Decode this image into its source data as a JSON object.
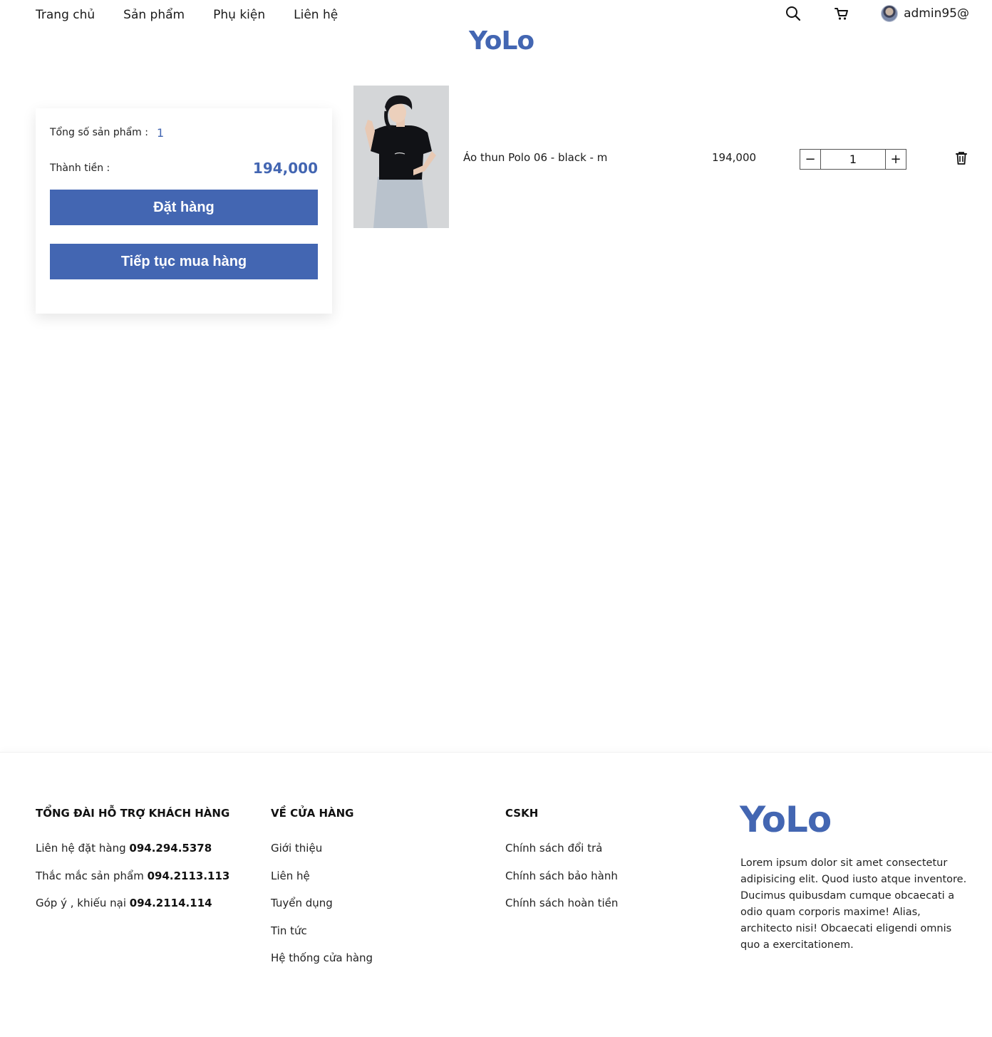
{
  "header": {
    "nav": [
      "Trang chủ",
      "Sản phẩm",
      "Phụ kiện",
      "Liên hệ"
    ],
    "logo": "YoLo",
    "username": "admin95@",
    "icons": {
      "search": "search-icon",
      "cart": "cart-icon",
      "avatar": "avatar"
    }
  },
  "summary": {
    "count_label": "Tổng số sản phẩm :",
    "count_value": "1",
    "total_label": "Thành tiền :",
    "total_value": "194,000",
    "order_button": "Đặt hàng",
    "continue_button": "Tiếp tục mua hàng"
  },
  "cart_item": {
    "name": "Áo thun Polo 06 - black - m",
    "price": "194,000",
    "quantity": "1",
    "minus_label": "−",
    "plus_label": "+"
  },
  "footer": {
    "support": {
      "title": "TỔNG ĐÀI HỖ TRỢ KHÁCH HÀNG",
      "lines": [
        {
          "label": "Liên hệ đặt hàng",
          "phone": "094.294.5378"
        },
        {
          "label": "Thắc mắc sản phẩm",
          "phone": "094.2113.113"
        },
        {
          "label": "Góp ý , khiếu nại",
          "phone": "094.2114.114"
        }
      ]
    },
    "store": {
      "title": "VỀ CỬA HÀNG",
      "links": [
        "Giới thiệu",
        "Liên hệ",
        "Tuyển dụng",
        "Tin tức",
        "Hệ thống cửa hàng"
      ]
    },
    "cskh": {
      "title": "CSKH",
      "links": [
        "Chính sách đổi trả",
        "Chính sách bảo hành",
        "Chính sách hoàn tiền"
      ]
    },
    "logo": "YoLo",
    "description": "Lorem ipsum dolor sit amet consectetur adipisicing elit. Quod iusto atque inventore. Ducimus quibusdam cumque obcaecati a odio quam corporis maxime! Alias, architecto nisi! Obcaecati eligendi omnis quo a exercitationem."
  },
  "colors": {
    "brand": "#4366b2"
  }
}
